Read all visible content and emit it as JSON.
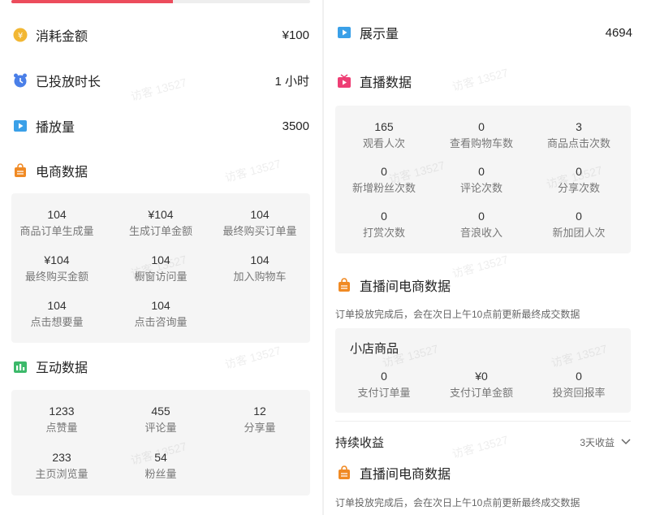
{
  "progress_fraction": 0.54,
  "left": {
    "rows": [
      {
        "label": "消耗金额",
        "value": "¥100",
        "icon": "coin-icon"
      },
      {
        "label": "已投放时长",
        "value": "1 小时",
        "icon": "alarm-clock-icon"
      },
      {
        "label": "播放量",
        "value": "3500",
        "icon": "play-icon"
      }
    ],
    "ecommerce": {
      "title": "电商数据",
      "icon": "shopping-bag-icon",
      "cells": [
        {
          "num": "104",
          "cap": "商品订单生成量"
        },
        {
          "num": "¥104",
          "cap": "生成订单金额"
        },
        {
          "num": "104",
          "cap": "最终购买订单量"
        },
        {
          "num": "¥104",
          "cap": "最终购买金额"
        },
        {
          "num": "104",
          "cap": "橱窗访问量"
        },
        {
          "num": "104",
          "cap": "加入购物车"
        },
        {
          "num": "104",
          "cap": "点击想要量"
        },
        {
          "num": "104",
          "cap": "点击咨询量"
        }
      ]
    },
    "interaction": {
      "title": "互动数据",
      "icon": "bar-chart-icon",
      "cells": [
        {
          "num": "1233",
          "cap": "点赞量"
        },
        {
          "num": "455",
          "cap": "评论量"
        },
        {
          "num": "12",
          "cap": "分享量"
        },
        {
          "num": "233",
          "cap": "主页浏览量"
        },
        {
          "num": "54",
          "cap": "粉丝量"
        }
      ]
    }
  },
  "right": {
    "impressions": {
      "label": "展示量",
      "value": "4694",
      "icon": "play-icon"
    },
    "live": {
      "title": "直播数据",
      "icon": "live-tv-icon",
      "cells": [
        {
          "num": "165",
          "cap": "观看人次"
        },
        {
          "num": "0",
          "cap": "查看购物车数"
        },
        {
          "num": "3",
          "cap": "商品点击次数"
        },
        {
          "num": "0",
          "cap": "新增粉丝次数"
        },
        {
          "num": "0",
          "cap": "评论次数"
        },
        {
          "num": "0",
          "cap": "分享次数"
        },
        {
          "num": "0",
          "cap": "打赏次数"
        },
        {
          "num": "0",
          "cap": "音浪收入"
        },
        {
          "num": "0",
          "cap": "新加团人次"
        }
      ]
    },
    "live_ecommerce": {
      "title": "直播间电商数据",
      "icon": "shopping-bag-icon",
      "note": "订单投放完成后，会在次日上午10点前更新最终成交数据",
      "store_title": "小店商品",
      "cells": [
        {
          "num": "0",
          "cap": "支付订单量"
        },
        {
          "num": "¥0",
          "cap": "支付订单金额"
        },
        {
          "num": "0",
          "cap": "投资回报率"
        }
      ]
    },
    "ongoing": {
      "label": "持续收益",
      "dropdown": "3天收益"
    },
    "live_ecommerce_2": {
      "title": "直播间电商数据",
      "note": "订单投放完成后，会在次日上午10点前更新最终成交数据"
    }
  },
  "watermark": "访客 13527",
  "colors": {
    "accent": "#ec4c5c",
    "coin": "#f2b733",
    "clock": "#4a7fe8",
    "play": "#3aa0e8",
    "bag": "#f08a24",
    "chart": "#3cb96a",
    "live": "#ee3e74"
  }
}
